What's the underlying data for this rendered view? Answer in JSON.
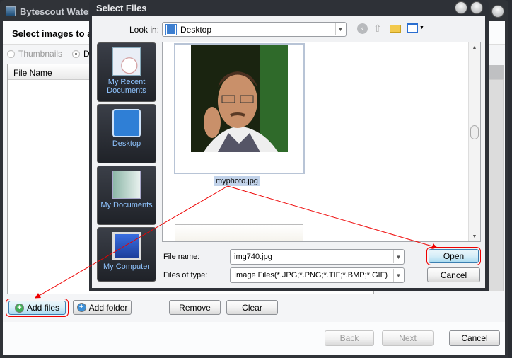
{
  "main_window": {
    "title": "Bytescout Watermarking",
    "heading": "Select images to apply watermark",
    "view_options": [
      {
        "label": "Thumbnails",
        "selected": false
      },
      {
        "label": "Details",
        "selected": true
      }
    ],
    "list": {
      "column_header": "File Name",
      "rows": []
    },
    "buttons": {
      "add_files": "Add files",
      "add_folder": "Add folder",
      "remove": "Remove",
      "clear": "Clear",
      "back": "Back",
      "next": "Next",
      "cancel": "Cancel"
    }
  },
  "dialog": {
    "title": "Select Files",
    "look_in_label": "Look in:",
    "look_in_value": "Desktop",
    "toolbar_icons": [
      "back-icon",
      "up-folder-icon",
      "new-folder-icon",
      "view-menu-icon"
    ],
    "places": [
      {
        "label": "My Recent Documents",
        "icon": "recent-documents-icon"
      },
      {
        "label": "Desktop",
        "icon": "desktop-icon"
      },
      {
        "label": "My Documents",
        "icon": "my-documents-icon"
      },
      {
        "label": "My Computer",
        "icon": "my-computer-icon"
      }
    ],
    "files": [
      {
        "name": "myphoto.jpg",
        "selected": true
      }
    ],
    "file_name_label": "File name:",
    "file_name_value": "img740.jpg",
    "file_type_label": "Files of type:",
    "file_type_value": "Image Files(*.JPG;*.PNG;*.TIF;*.BMP;*.GIF)",
    "open_label": "Open",
    "cancel_label": "Cancel"
  },
  "colors": {
    "annotation": "#e00000",
    "selection": "#c2d3ea",
    "places_text": "#8fc4ff"
  }
}
